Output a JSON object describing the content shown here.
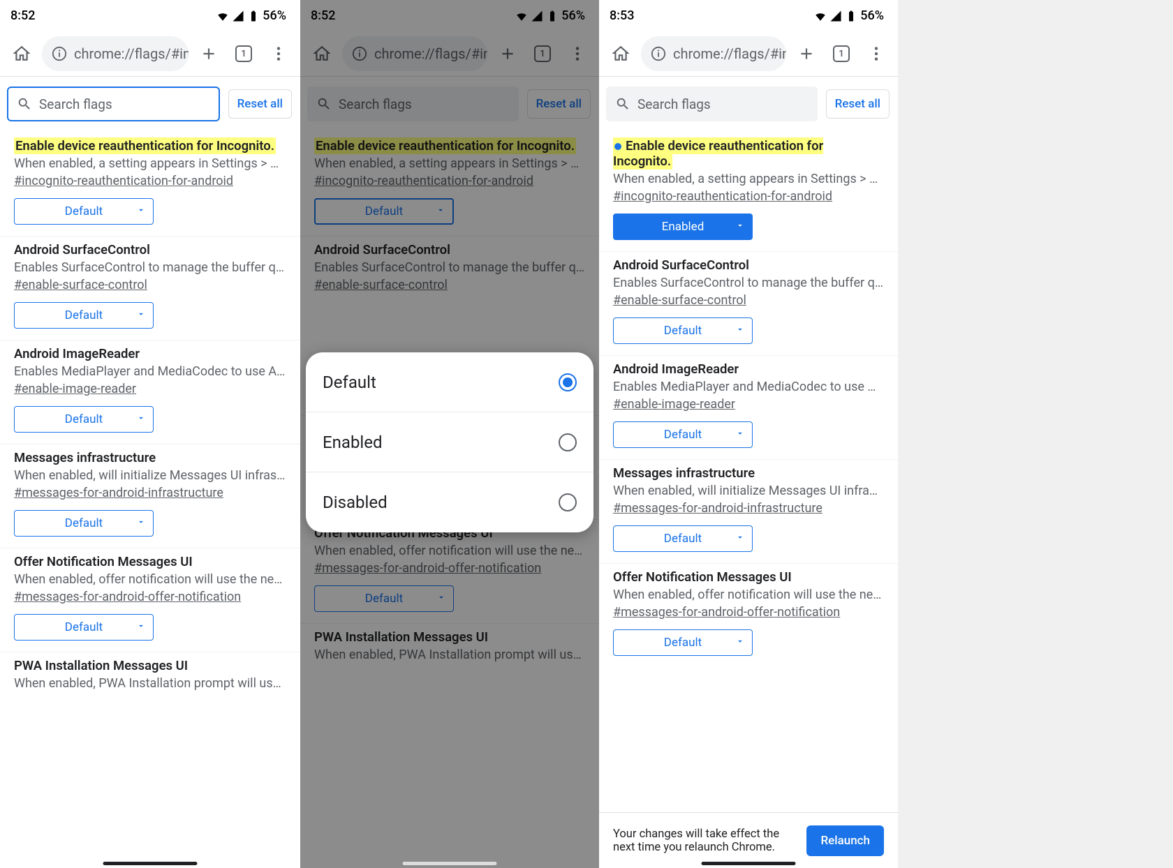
{
  "status1": {
    "time": "8:52",
    "battery": "56%"
  },
  "status2": {
    "time": "8:52",
    "battery": "56%"
  },
  "status3": {
    "time": "8:53",
    "battery": "56%"
  },
  "omnibox_url": "chrome://flags/#incogni",
  "tab_count": "1",
  "search_placeholder": "Search flags",
  "reset_label": "Reset all",
  "flags": [
    {
      "title": "Enable device reauthentication for Incognito.",
      "desc": "When enabled, a setting appears in Settings > Privacy and Se…",
      "anchor": "#incognito-reauthentication-for-android",
      "val_a": "Default",
      "val_c": "Enabled"
    },
    {
      "title": "Android SurfaceControl",
      "desc": "Enables SurfaceControl to manage the buffer queue for the …",
      "anchor": "#enable-surface-control",
      "val_a": "Default",
      "val_c": "Default"
    },
    {
      "title": "Android ImageReader",
      "desc": "Enables MediaPlayer and MediaCodec to use AImageReader…",
      "anchor": "#enable-image-reader",
      "val_a": "Default",
      "val_c": "Default"
    },
    {
      "title": "Messages infrastructure",
      "desc": "When enabled, will initialize Messages UI infrastructure – An…",
      "anchor": "#messages-for-android-infrastructure",
      "val_a": "Default",
      "val_c": "Default"
    },
    {
      "title": "Offer Notification Messages UI",
      "desc": "When enabled, offer notification will use the new Messages …",
      "anchor": "#messages-for-android-offer-notification",
      "val_a": "Default",
      "val_c": "Default"
    },
    {
      "title": "PWA Installation Messages UI",
      "desc": "When enabled, PWA Installation prompt will use the new Mes…",
      "anchor": "",
      "val_a": "",
      "val_c": ""
    }
  ],
  "popup": {
    "options": [
      "Default",
      "Enabled",
      "Disabled"
    ]
  },
  "relaunch": {
    "msg": "Your changes will take effect the next time you relaunch Chrome.",
    "btn": "Relaunch"
  }
}
